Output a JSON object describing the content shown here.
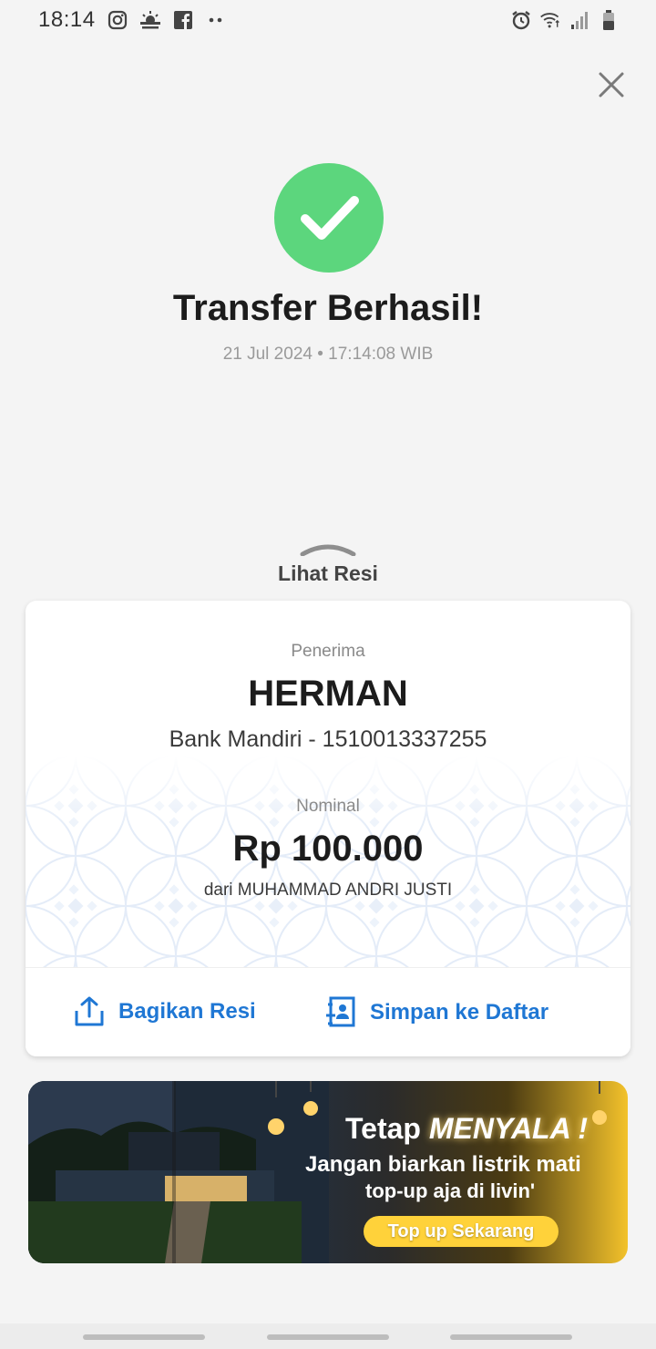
{
  "status_bar": {
    "time": "18:14",
    "left_icons": [
      "instagram-icon",
      "weather-icon",
      "facebook-icon",
      "more-dots-icon"
    ],
    "right_icons": [
      "alarm-icon",
      "wifi-icon",
      "signal-icon",
      "battery-icon"
    ]
  },
  "header": {
    "close_icon": "close-icon"
  },
  "success": {
    "title": "Transfer Berhasil!",
    "datetime": "21 Jul 2024 • 17:14:08 WIB",
    "icon_color": "#5cd67d"
  },
  "receipt_toggle": {
    "label": "Lihat Resi"
  },
  "receipt": {
    "recipient_caption": "Penerima",
    "recipient_name": "HERMAN",
    "recipient_bank": "Bank Mandiri - 1510013337255",
    "amount_caption": "Nominal",
    "amount_value": "Rp 100.000",
    "amount_source": "dari MUHAMMAD ANDRI JUSTI",
    "actions": {
      "share_label": "Bagikan Resi",
      "save_label": "Simpan ke Daftar",
      "accent_color": "#1f77d4"
    }
  },
  "banner": {
    "title_prefix": "Tetap",
    "title_highlight": "MENYALA !",
    "line1": "Jangan biarkan listrik mati",
    "line2": "top-up aja di livin'",
    "cta": "Top up Sekarang"
  }
}
